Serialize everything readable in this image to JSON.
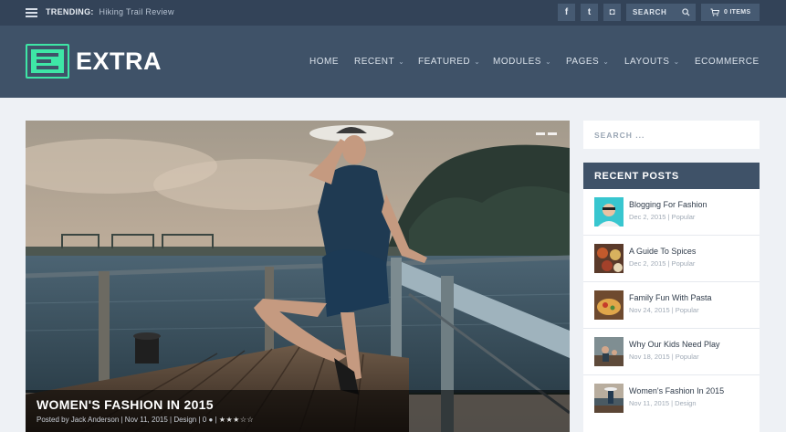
{
  "topbar": {
    "trending_label": "TRENDING:",
    "trending_value": "Hiking Trail Review",
    "social": [
      {
        "icon": "facebook-icon",
        "glyph": "f"
      },
      {
        "icon": "twitter-icon",
        "glyph": "t"
      },
      {
        "icon": "instagram-icon",
        "glyph": "◘"
      }
    ],
    "search_label": "SEARCH",
    "cart_label": "0 ITEMS"
  },
  "header": {
    "logo_text": "EXTRA",
    "logo_color": "#3ee6a6",
    "nav": [
      "HOME",
      "RECENT",
      "FEATURED",
      "MODULES",
      "PAGES",
      "LAYOUTS",
      "ECOMMERCE"
    ]
  },
  "hero": {
    "title": "WOMEN'S FASHION IN 2015",
    "meta": "Posted by Jack Anderson | Nov 11, 2015 | Design | 0",
    "rating_stars": "★★★☆☆"
  },
  "sidebar": {
    "search_placeholder": "SEARCH ...",
    "recent_title": "RECENT POSTS",
    "posts": [
      {
        "title": "Blogging For Fashion",
        "meta": "Dec 2, 2015 | Popular"
      },
      {
        "title": "A Guide To Spices",
        "meta": "Dec 2, 2015 | Popular"
      },
      {
        "title": "Family Fun With Pasta",
        "meta": "Nov 24, 2015 | Popular"
      },
      {
        "title": "Why Our Kids Need Play",
        "meta": "Nov 18, 2015 | Popular"
      },
      {
        "title": "Women's Fashion In 2015",
        "meta": "Nov 11, 2015 | Design"
      }
    ]
  },
  "colors": {
    "topbar": "#334358",
    "header": "#3f5268",
    "accent": "#3ee6a6",
    "page_bg": "#eef1f5"
  }
}
